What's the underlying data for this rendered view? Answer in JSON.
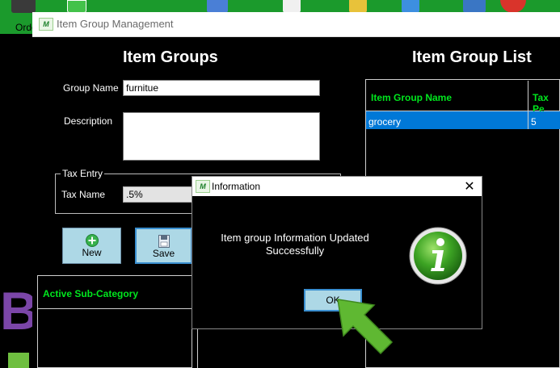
{
  "toolbar": {
    "order_label": "Orde"
  },
  "window": {
    "title": "Item Group Management",
    "icon_text": "M"
  },
  "form": {
    "heading": "Item Groups",
    "group_name_label": "Group Name",
    "group_name_value": "furnitue",
    "description_label": "Description",
    "description_value": "",
    "tax_entry_legend": "Tax Entry",
    "tax_name_label": "Tax Name",
    "tax_name_value": ".5%",
    "new_label": "New",
    "save_label": "Save"
  },
  "subcategory": {
    "header": "Active Sub-Category"
  },
  "list": {
    "heading": "Item Group List",
    "columns": [
      "Item Group Name",
      "Tax Pe"
    ],
    "rows": [
      [
        "grocery",
        "5"
      ]
    ]
  },
  "dialog": {
    "title": "Information",
    "icon_text": "M",
    "message_line1": "Item group Information Updated",
    "message_line2": "Successfully",
    "ok_label": "OK",
    "close_glyph": "✕"
  },
  "colors": {
    "toolbar_green": "#1b9a2c",
    "header_green_text": "#00e61e",
    "selection_blue": "#0078d7",
    "button_blue": "#add8e6",
    "arrow_green": "#5fb832"
  },
  "icons": [
    "save-icon",
    "add-icon",
    "chart-icon",
    "document-icon",
    "key-icon",
    "refresh-icon",
    "calculator-icon",
    "close-circle-icon",
    "info-icon",
    "arrow-pointer-icon"
  ]
}
